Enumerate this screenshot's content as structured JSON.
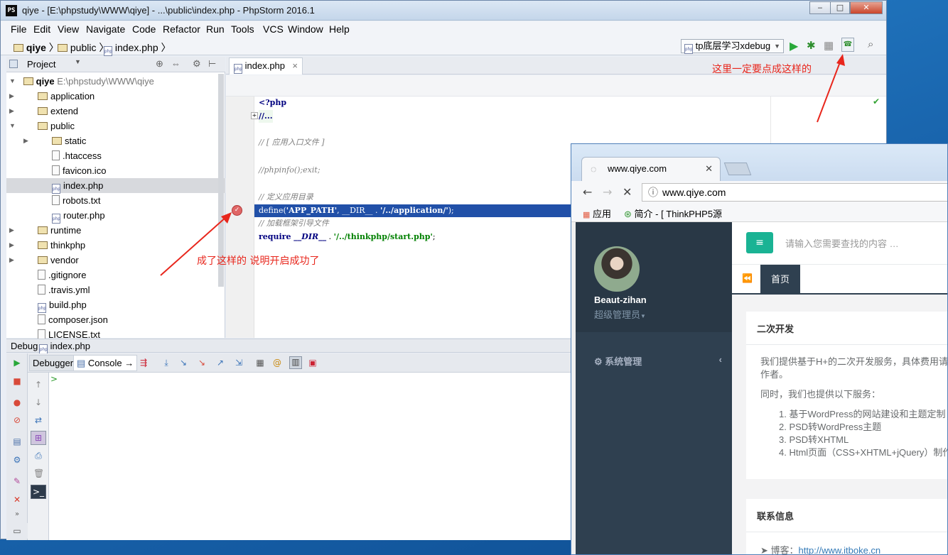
{
  "window": {
    "title": "qiye - [E:\\phpstudy\\WWW\\qiye] - ...\\public\\index.php - PhpStorm 2016.1",
    "logo": "PS"
  },
  "menu": [
    "File",
    "Edit",
    "View",
    "Navigate",
    "Code",
    "Refactor",
    "Run",
    "Tools",
    "VCS",
    "Window",
    "Help"
  ],
  "breadcrumb": [
    "qiye",
    "public",
    "index.php"
  ],
  "run_config": "tp底层学习xdebug",
  "project_panel": {
    "title": "Project",
    "root_name": "qiye",
    "root_path": "E:\\phpstudy\\WWW\\qiye",
    "items": [
      {
        "label": "application",
        "type": "folder"
      },
      {
        "label": "extend",
        "type": "folder"
      },
      {
        "label": "public",
        "type": "folder"
      },
      {
        "label": "static",
        "type": "folder"
      },
      {
        "label": ".htaccess",
        "type": "file"
      },
      {
        "label": "favicon.ico",
        "type": "file"
      },
      {
        "label": "index.php",
        "type": "php"
      },
      {
        "label": "robots.txt",
        "type": "file"
      },
      {
        "label": "router.php",
        "type": "php"
      },
      {
        "label": "runtime",
        "type": "folder"
      },
      {
        "label": "thinkphp",
        "type": "folder"
      },
      {
        "label": "vendor",
        "type": "folder"
      },
      {
        "label": ".gitignore",
        "type": "file"
      },
      {
        "label": ".travis.yml",
        "type": "file"
      },
      {
        "label": "build.php",
        "type": "php"
      },
      {
        "label": "composer.json",
        "type": "file"
      },
      {
        "label": "LICENSE.txt",
        "type": "file"
      }
    ]
  },
  "editor": {
    "tab": "index.php",
    "lines": {
      "l1": "<?php",
      "l2": "//...",
      "l3": "// [ 应用入口文件 ]",
      "l4": "//phpinfo();exit;",
      "l5": "// 定义应用目录",
      "l6a": "define(",
      "l6b": "'APP_PATH'",
      "l6c": ", __DIR__ . ",
      "l6d": "'/../application/'",
      "l6e": ");",
      "l7": "// 加载框架引导文件",
      "l8a": "require ",
      "l8b": "__DIR__",
      "l8c": " . ",
      "l8d": "'/../thinkphp/start.php'",
      "l8e": ";"
    }
  },
  "debug": {
    "label": "Debug",
    "file": "index.php",
    "tabs": {
      "debugger": "Debugger",
      "console": "Console"
    },
    "prompt": ">"
  },
  "annotations": {
    "top": "这里一定要点成这样的",
    "middle": "成了这样的 说明开启成功了"
  },
  "browser": {
    "tab_title": "www.qiye.com",
    "address": "www.qiye.com",
    "bookmarks": {
      "apps": "应用",
      "b1": "简介 - [ ThinkPHP5源"
    },
    "search_placeholder": "请输入您需要查找的内容 …",
    "user_name": "Beaut-zihan",
    "user_role": "超级管理员",
    "nav_item": "系统管理",
    "page_tab": "首页",
    "section1_title": "二次开发",
    "section1_p1": "我们提供基于H+的二次开发服务，具体费用请",
    "section1_p1b": "作者。",
    "section1_p2": "同时，我们也提供以下服务：",
    "list": [
      "1. 基于WordPress的网站建设和主题定制",
      "2. PSD转WordPress主题",
      "3. PSD转XHTML",
      "4. Html页面（CSS+XHTML+jQuery）制作"
    ],
    "section2_title": "联系信息",
    "blog_label": "博客：",
    "blog_url": "http://www.itboke.cn"
  },
  "colors": {
    "annotation": "#e8261c",
    "highlight": "#2150a8",
    "sidebar": "#2f4050",
    "accent": "#1ab394"
  }
}
